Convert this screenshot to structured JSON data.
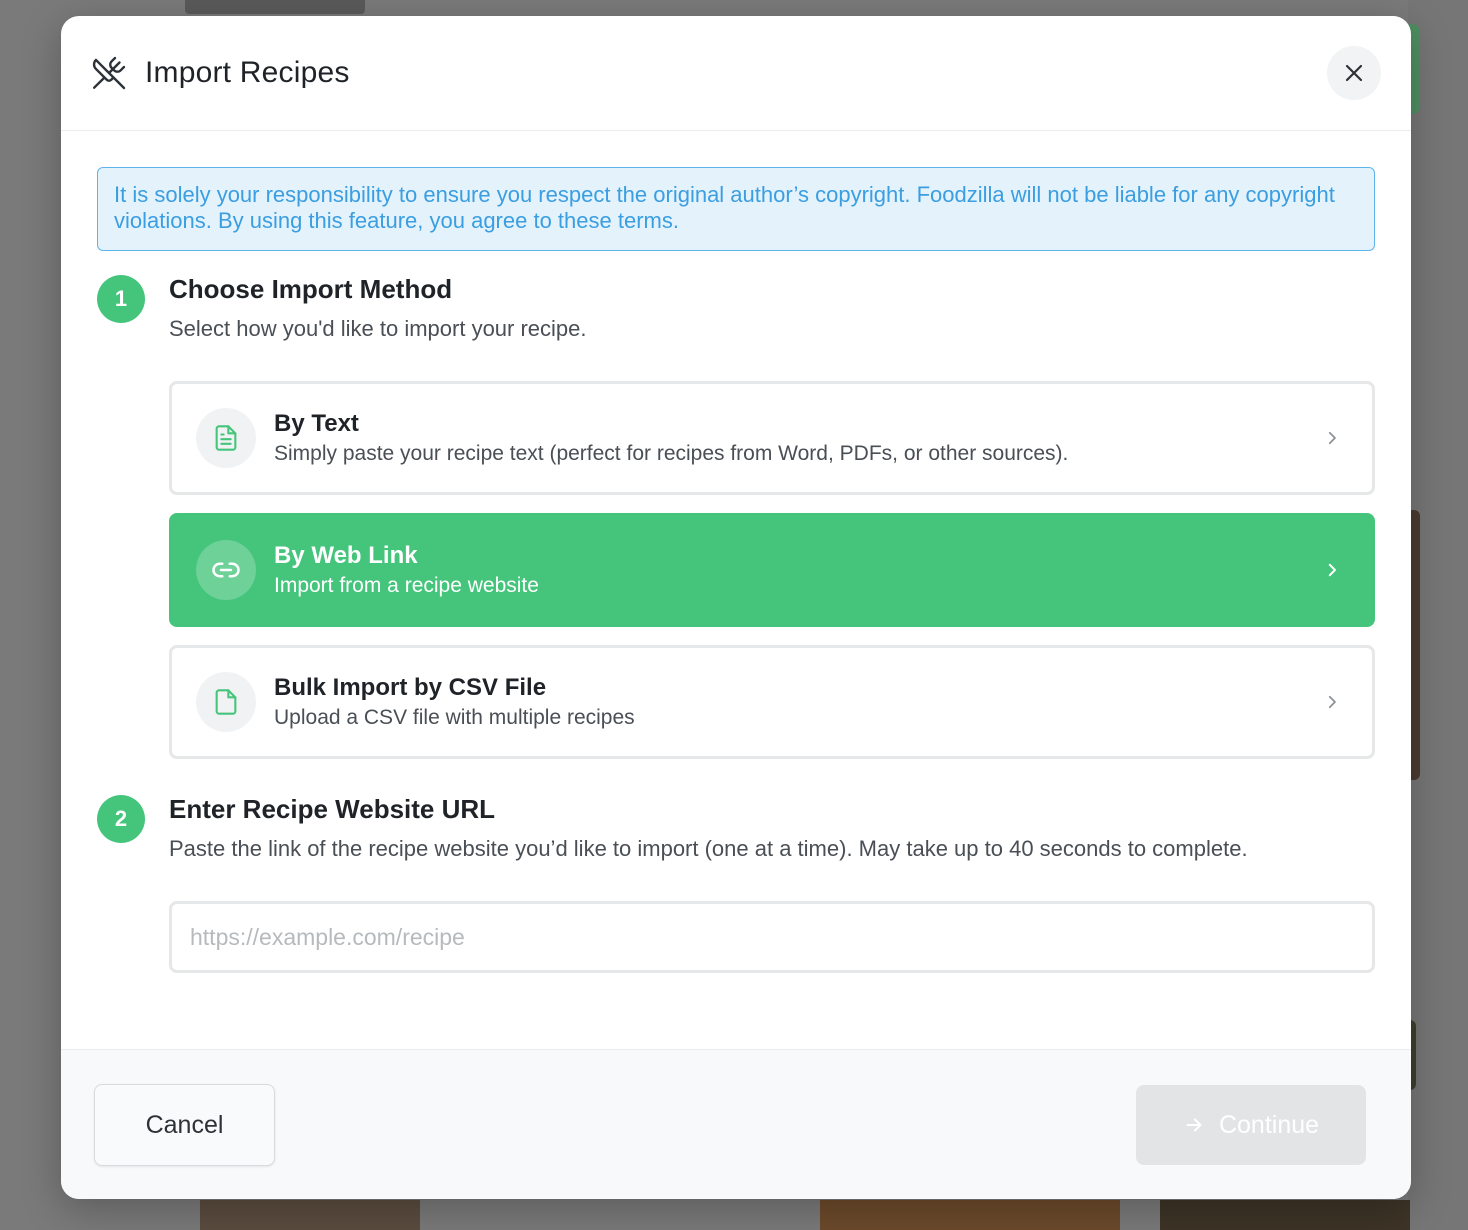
{
  "modal": {
    "title": "Import Recipes",
    "header_icon": "utensils-crossed-icon",
    "close_icon": "close-icon"
  },
  "notice": {
    "text": "It is solely your responsibility to ensure you respect the original author’s copyright. Foodzilla will not be liable for any copyright violations. By using this feature, you agree to these terms."
  },
  "step1": {
    "number": "1",
    "title": "Choose Import Method",
    "description": "Select how you'd like to import your recipe.",
    "options": [
      {
        "title": "By Text",
        "description": "Simply paste your recipe text (perfect for recipes from Word, PDFs, or other sources).",
        "icon": "file-text-icon",
        "selected": false
      },
      {
        "title": "By Web Link",
        "description": "Import from a recipe website",
        "icon": "link-icon",
        "selected": true
      },
      {
        "title": "Bulk Import by CSV File",
        "description": "Upload a CSV file with multiple recipes",
        "icon": "file-icon",
        "selected": false
      }
    ]
  },
  "step2": {
    "number": "2",
    "title": "Enter Recipe Website URL",
    "description": "Paste the link of the recipe website you’d like to import (one at a time). May take up to 40 seconds to complete.",
    "url_value": "",
    "url_placeholder": "https://example.com/recipe"
  },
  "footer": {
    "cancel_label": "Cancel",
    "continue_label": "Continue",
    "continue_icon": "arrow-right-icon"
  },
  "colors": {
    "accent_green": "#45c57c",
    "notice_blue": "#3a9ee0",
    "notice_bg": "#e4f2fc"
  }
}
